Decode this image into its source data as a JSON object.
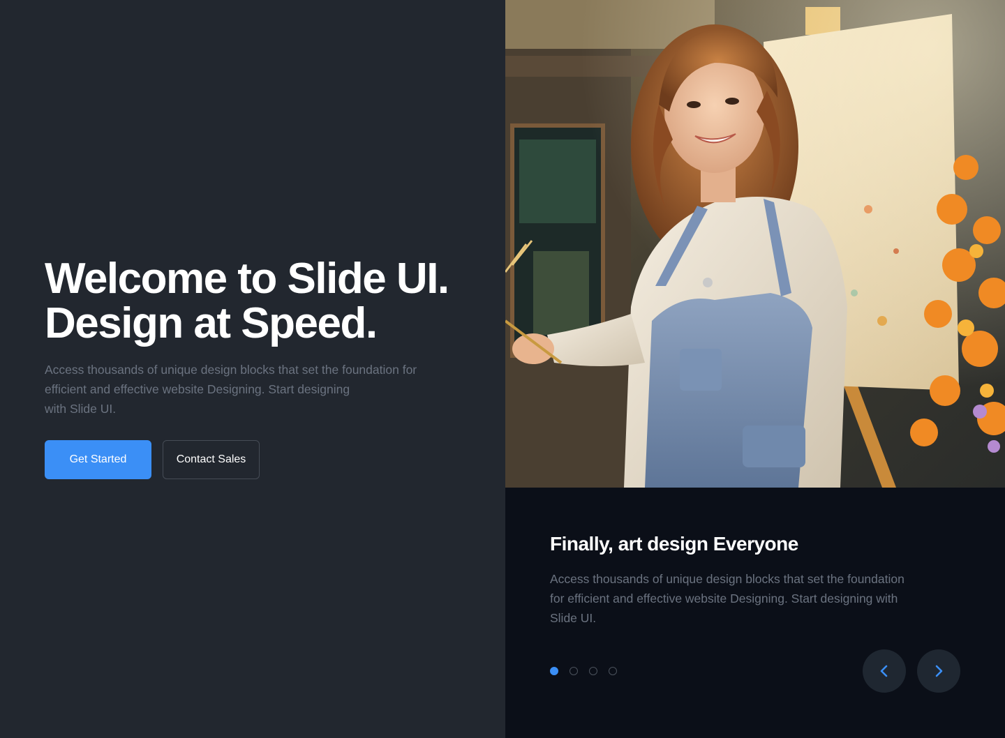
{
  "hero": {
    "title_line1": "Welcome to Slide UI.",
    "title_line2": "Design at Speed.",
    "desc_line1": "Access thousands of unique design blocks that set the foundation for",
    "desc_line2": "efficient and effective website Designing. Start designing",
    "desc_line3": "with Slide UI.",
    "primary_button": "Get Started",
    "secondary_button": "Contact Sales"
  },
  "slide": {
    "title": "Finally, art design Everyone",
    "desc_line1": "Access thousands of unique design blocks that set the foundation",
    "desc_line2": "for efficient and effective website Designing. Start designing with",
    "desc_line3": "Slide UI.",
    "active_index": 0,
    "total": 4
  },
  "icons": {
    "prev": "chevron-left-icon",
    "next": "chevron-right-icon"
  },
  "colors": {
    "accent": "#3b8ff6",
    "left_bg": "#22272f",
    "right_bg": "#0b0f18",
    "muted_text": "#6b7380"
  }
}
